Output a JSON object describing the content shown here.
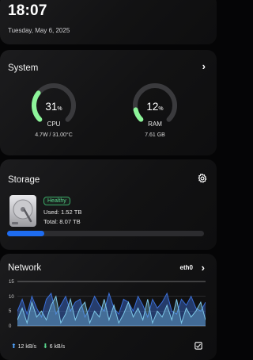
{
  "header": {
    "time": "18:07",
    "date": "Tuesday, May 6, 2025"
  },
  "system": {
    "title": "System",
    "cpu": {
      "value": "31",
      "unit": "%",
      "label": "CPU",
      "detail": "4.7W / 31.00°C",
      "percent": 31,
      "color": "#8df59a"
    },
    "ram": {
      "value": "12",
      "unit": "%",
      "label": "RAM",
      "detail": "7.61 GB",
      "percent": 12,
      "color": "#8df59a"
    }
  },
  "storage": {
    "title": "Storage",
    "status": "Healthy",
    "used": "Used: 1.52 TB",
    "total": "Total: 8.07 TB",
    "used_fraction": 0.19,
    "bar_color": "#1e6cf0"
  },
  "network": {
    "title": "Network",
    "interface": "eth0",
    "upload": "12 kB/s",
    "download": "6 kB/s",
    "y_ticks": [
      "15",
      "10",
      "5",
      "0"
    ],
    "chart_data": {
      "type": "area",
      "ylim": [
        0,
        15
      ],
      "series": [
        {
          "color": "#3b6fd8",
          "values": [
            5,
            9,
            4,
            10,
            6,
            3,
            9,
            11,
            4,
            7,
            10,
            5,
            8,
            9,
            3,
            6,
            10,
            7,
            5,
            11,
            6,
            4,
            9,
            8,
            5,
            10,
            7,
            3,
            9,
            6,
            8,
            11,
            5,
            4,
            9,
            7,
            10,
            6,
            5,
            8
          ]
        },
        {
          "color": "#7ec8e8",
          "values": [
            2,
            6,
            1,
            8,
            3,
            5,
            2,
            7,
            10,
            1,
            4,
            9,
            2,
            6,
            8,
            1,
            5,
            3,
            9,
            2,
            7,
            1,
            4,
            8,
            3,
            6,
            2,
            9,
            1,
            5,
            3,
            7,
            2,
            9,
            1,
            6,
            3,
            5,
            8,
            2
          ]
        }
      ]
    }
  }
}
